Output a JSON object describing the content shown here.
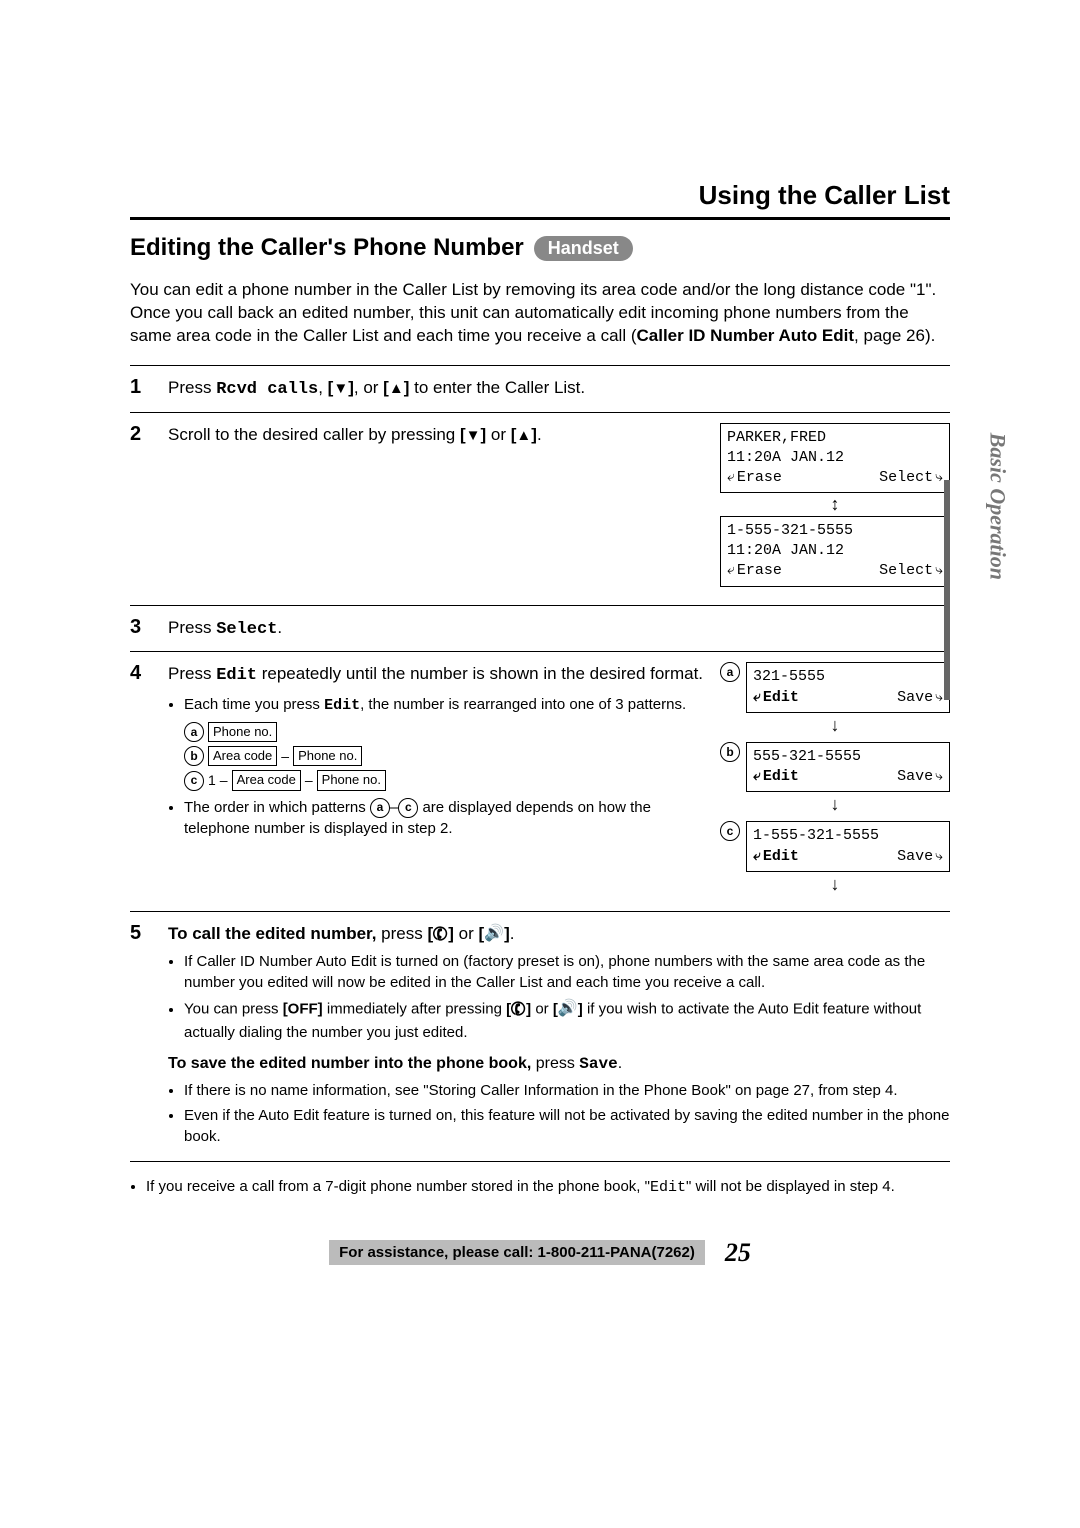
{
  "section_title": "Using the Caller List",
  "heading": "Editing the Caller's Phone Number",
  "heading_pill": "Handset",
  "intro_1": "You can edit a phone number in the Caller List by removing its area code and/or the long distance code \"1\".",
  "intro_2": "Once you call back an edited number, this unit can automatically edit incoming phone numbers from the same area code in the Caller List and each time you receive a call (",
  "intro_bold": "Caller ID Number Auto Edit",
  "intro_3": ", page 26).",
  "step1_prefix": "Press ",
  "step1_mono": "Rcvd calls",
  "step1_suffix": " to enter the Caller List.",
  "step2_prefix": "Scroll to the desired caller by pressing ",
  "step2_suffix": " or ",
  "step3_prefix": "Press ",
  "step3_mono": "Select",
  "step4_prefix": "Press ",
  "step4_mono": "Edit",
  "step4_mid": " repeatedly until the number is shown in the desired format.",
  "step4_b1_prefix": "Each time you press ",
  "step4_b1_mono": "Edit",
  "step4_b1_suffix": ", the number is rearranged into one of 3 patterns.",
  "pattern_a_label": "a",
  "pattern_b_label": "b",
  "pattern_c_label": "c",
  "phone_no_label": "Phone no.",
  "area_code_label": "Area code",
  "one_prefix": "1",
  "dash": "–",
  "step4_b2_prefix": "The order in which patterns ",
  "step4_b2_mid": "–",
  "step4_b2_suffix": " are displayed depends on how the telephone number is displayed in step 2.",
  "step5_bold": "To call the edited number,",
  "step5_mid": " press ",
  "step5_or": " or ",
  "step5_b1": "If Caller ID Number Auto Edit is turned on (factory preset is on), phone numbers with the same area code as the number you edited will now be edited in the Caller List and each time you receive a call.",
  "step5_b2_prefix": "You can press ",
  "step5_b2_off": "[OFF]",
  "step5_b2_mid": " immediately after pressing ",
  "step5_b2_or": " or ",
  "step5_b2_suffix": " if you wish to activate the Auto Edit feature without actually dialing the number you just edited.",
  "save_head_bold": "To save the edited number into the phone book,",
  "save_head_mid": " press ",
  "save_head_mono": "Save",
  "save_b1": "If there is no name information, see \"Storing Caller Information in the Phone Book\" on page 27, from step 4.",
  "save_b2": "Even if the Auto Edit feature is turned on, this feature will not be activated by saving the edited number in the phone book.",
  "note_prefix": "If you receive a call from a 7-digit phone number stored in the phone book, \"",
  "note_mono": "Edit",
  "note_suffix": "\" will not be displayed in step 4.",
  "footer_text": "For assistance, please call: 1-800-211-PANA(7262)",
  "page_number": "25",
  "side_tab": "Basic Operation",
  "lcd1": {
    "line1": "PARKER,FRED",
    "line2": "11:20A JAN.12",
    "soft_left": "Erase",
    "soft_right": "Select"
  },
  "lcd2": {
    "line1": "1-555-321-5555",
    "line2": "11:20A JAN.12",
    "soft_left": "Erase",
    "soft_right": "Select"
  },
  "lcd_a": {
    "line1": "321-5555",
    "soft_left": "Edit",
    "soft_right": "Save"
  },
  "lcd_b": {
    "line1": "555-321-5555",
    "soft_left": "Edit",
    "soft_right": "Save"
  },
  "lcd_c": {
    "line1": "1-555-321-5555",
    "soft_left": "Edit",
    "soft_right": "Save"
  }
}
